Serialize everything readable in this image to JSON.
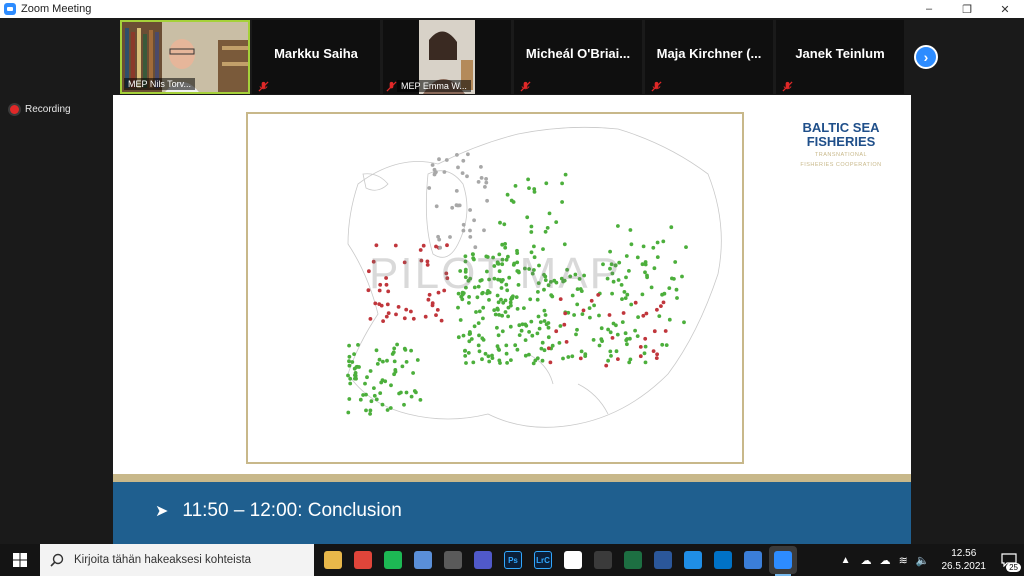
{
  "window": {
    "title": "Zoom Meeting",
    "minimize_glyph": "–",
    "restore_glyph": "❐",
    "close_glyph": "✕"
  },
  "gallery": {
    "participants": [
      {
        "name": "MEP Nils Torv...",
        "video": true,
        "speaking": true
      },
      {
        "name": "Markku Saiha",
        "video": false,
        "muted": true
      },
      {
        "name": "MEP Emma W...",
        "video": true,
        "muted": true
      },
      {
        "name": "Micheál O'Briai...",
        "video": false,
        "muted": true
      },
      {
        "name": "Maja Kirchner (...",
        "video": false,
        "muted": true
      },
      {
        "name": "Janek Teinlum",
        "video": false,
        "muted": true
      }
    ],
    "next_page_icon": "chevron-right-icon"
  },
  "recording": {
    "label": "Recording"
  },
  "slide": {
    "watermark": "PILOT MAP",
    "logo_line1": "BALTIC SEA",
    "logo_line2": "FISHERIES",
    "logo_tag1": "TRANSNATIONAL",
    "logo_tag2": "FISHERIES COOPERATION",
    "conclusion": "11:50 – 12:00: Conclusion",
    "colors": {
      "gold": "#c8b88a",
      "blue": "#1f5f8f",
      "green_dot": "#4caf3c",
      "red_dot": "#c0363c",
      "gray_dot": "#a8a8a8"
    }
  },
  "taskbar": {
    "search_placeholder": "Kirjoita tähän hakeaksesi kohteista",
    "apps": [
      {
        "name": "file-explorer-icon",
        "color": "#e8b84a"
      },
      {
        "name": "xmind-icon",
        "color": "#e0453a"
      },
      {
        "name": "spotify-icon",
        "color": "#1db954"
      },
      {
        "name": "app-s-icon",
        "color": "#5a8fd8"
      },
      {
        "name": "store-icon",
        "color": "#5a5a5a"
      },
      {
        "name": "teams-icon",
        "color": "#5059c9"
      },
      {
        "name": "photoshop-icon",
        "label": "Ps",
        "color": "#0a1f3a"
      },
      {
        "name": "lightroom-classic-icon",
        "label": "LrC",
        "color": "#0a1f3a"
      },
      {
        "name": "sonos-icon",
        "color": "#ffffff"
      },
      {
        "name": "obs-icon",
        "color": "#3b3b3b"
      },
      {
        "name": "excel-icon",
        "color": "#1d6f42"
      },
      {
        "name": "word-icon",
        "color": "#2b579a"
      },
      {
        "name": "edge-icon",
        "color": "#1f8ee6"
      },
      {
        "name": "outlook-icon",
        "color": "#0072c6"
      },
      {
        "name": "phone-icon",
        "color": "#3b7ed8"
      },
      {
        "name": "zoom-icon",
        "color": "#2d8cff",
        "active": true
      }
    ],
    "time": "12.56",
    "date": "26.5.2021",
    "notifications": "25"
  }
}
